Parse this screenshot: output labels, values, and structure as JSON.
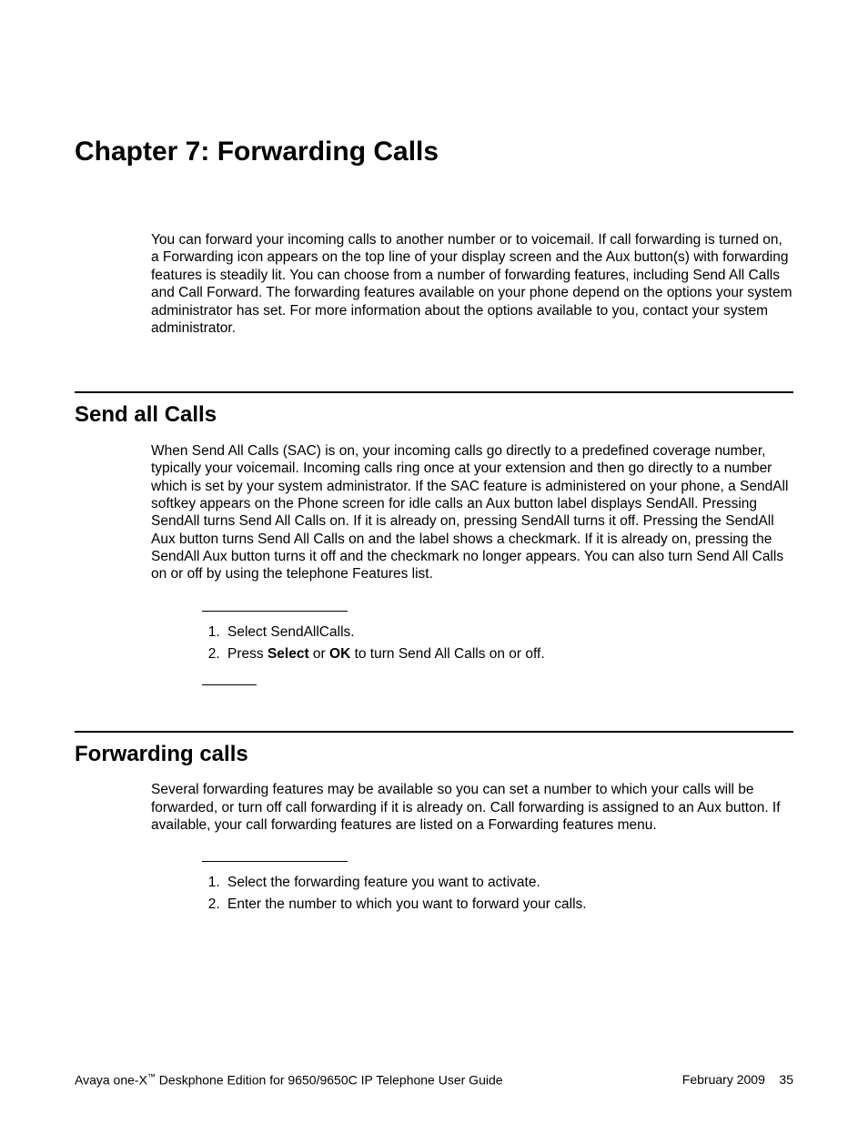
{
  "chapter": {
    "title": "Chapter 7:  Forwarding Calls",
    "intro": "You can forward your incoming calls to another number or to voicemail. If call forwarding is turned on, a Forwarding icon appears on the top line of your display screen and the Aux button(s) with forwarding features is steadily lit. You can choose from a number of forwarding features, including Send All Calls and Call Forward. The forwarding features available on your phone depend on the options your system administrator has set. For more information about the options available to you, contact your system administrator."
  },
  "section1": {
    "heading": "Send all Calls",
    "para": "When Send All Calls (SAC) is on, your incoming calls go directly to a predefined coverage number, typically your voicemail. Incoming calls ring once at your extension and then go directly to a number which is set by your system administrator. If the SAC feature is administered on your phone, a SendAll softkey appears on the Phone screen for idle calls an Aux button label displays SendAll. Pressing SendAll turns Send All Calls on. If it is already on, pressing SendAll turns it off. Pressing the SendAll Aux button turns Send All Calls on and the label shows a checkmark. If it is already on, pressing the SendAll Aux button turns it off and the checkmark no longer appears. You can also turn Send All Calls on or off by using the telephone Features list.",
    "step1": "Select SendAllCalls.",
    "step2_pre": "Press ",
    "step2_b1": "Select",
    "step2_mid": " or ",
    "step2_b2": "OK",
    "step2_post": " to turn Send All Calls on or off."
  },
  "section2": {
    "heading": "Forwarding calls",
    "para": "Several forwarding features may be available so you can set a number to which your calls will be forwarded, or turn off call forwarding if it is already on. Call forwarding is assigned to an Aux button. If available, your call forwarding features are listed on a Forwarding features menu.",
    "step1": "Select the forwarding feature you want to activate.",
    "step2": "Enter the number to which you want to forward your calls."
  },
  "footer": {
    "left_pre": "Avaya one-X",
    "left_tm": "™",
    "left_post": " Deskphone Edition for 9650/9650C IP Telephone User Guide",
    "date": "February 2009",
    "page": "35"
  }
}
